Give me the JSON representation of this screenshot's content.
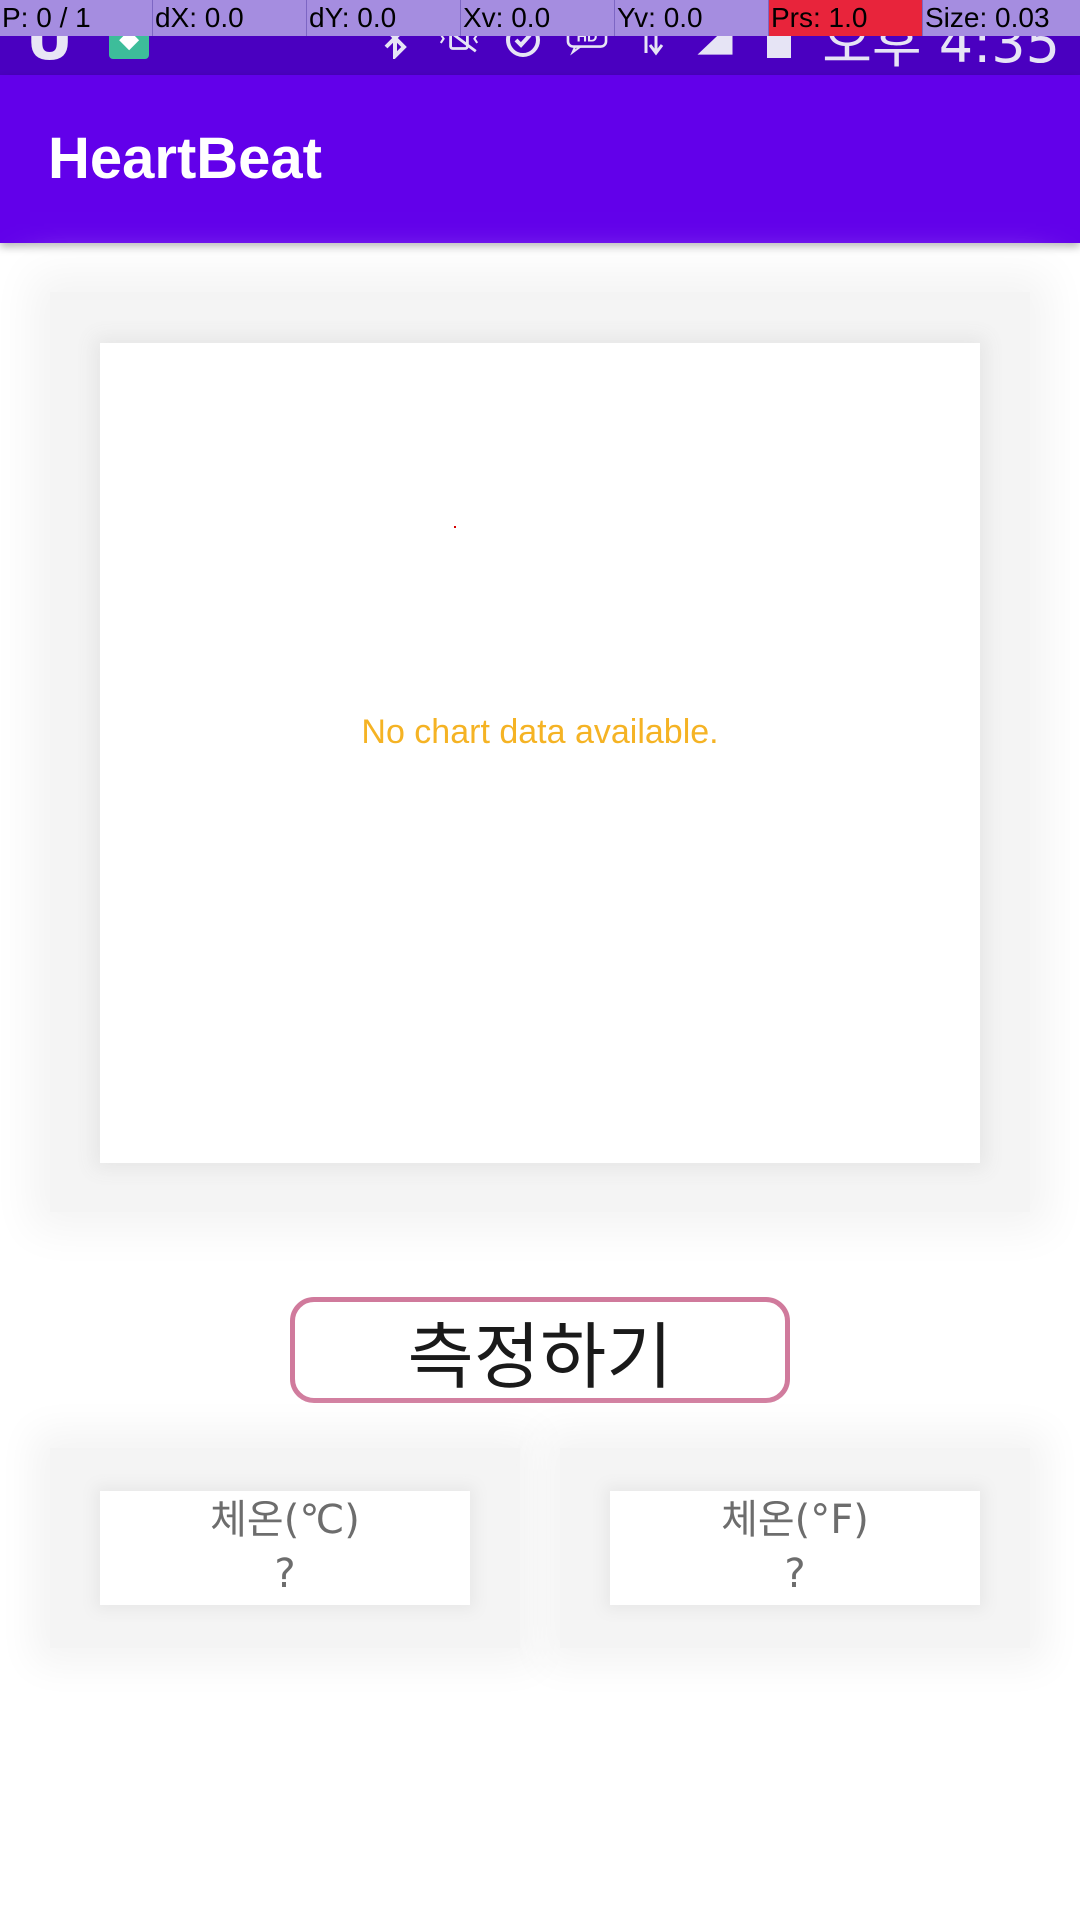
{
  "status_bar": {
    "clock": "오후 4:35",
    "notification_icons": [
      "u-notification-icon",
      "android-icon"
    ],
    "system_icons": [
      "bluetooth-icon",
      "vibrate-off-icon",
      "alarm-icon",
      "hd-icon",
      "data-arrows-icon",
      "signal-icon",
      "battery-icon"
    ]
  },
  "pointer_overlay": {
    "p": "P: 0 / 1",
    "dx": "dX: 0.0",
    "dy": "dY: 0.0",
    "xv": "Xv: 0.0",
    "yv": "Yv: 0.0",
    "prs": "Prs: 1.0",
    "size": "Size: 0.03"
  },
  "app_bar": {
    "title": "HeartBeat"
  },
  "chart": {
    "empty_message": "No chart data available."
  },
  "measure_button": {
    "label": "측정하기"
  },
  "temperature": {
    "celsius": {
      "label": "체온(℃)",
      "value": "?"
    },
    "fahrenheit": {
      "label": "체온(°F)",
      "value": "?"
    }
  },
  "colors": {
    "app_bar": "#6200ea",
    "status_bar": "#4a00c0",
    "empty_message": "#f5b324",
    "button_border": "#d07a9c"
  }
}
